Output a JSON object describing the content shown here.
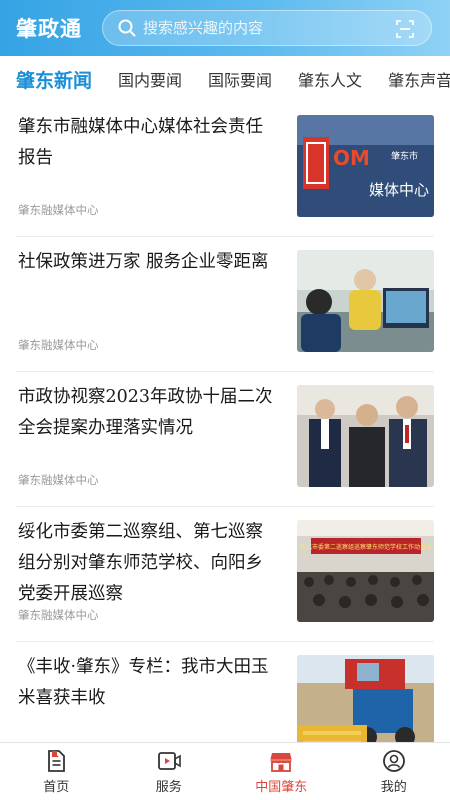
{
  "header": {
    "app_title": "肇政通",
    "search_placeholder": "搜索感兴趣的内容",
    "search_icon": "search-icon",
    "scan_icon": "scan-icon"
  },
  "tabs": [
    {
      "label": "肇东新闻",
      "active": true
    },
    {
      "label": "国内要闻"
    },
    {
      "label": "国际要闻"
    },
    {
      "label": "肇东人文"
    },
    {
      "label": "肇东声音"
    }
  ],
  "news": [
    {
      "title": "肇东市融媒体中心媒体社会责任报告",
      "source": "肇东融媒体中心"
    },
    {
      "title": "社保政策进万家 服务企业零距离",
      "source": "肇东融媒体中心"
    },
    {
      "title": "市政协视察2023年政协十届二次全会提案办理落实情况",
      "source": "肇东融媒体中心"
    },
    {
      "title": "绥化市委第二巡察组、第七巡察组分别对肇东师范学校、向阳乡党委开展巡察",
      "source": "肇东融媒体中心"
    },
    {
      "title": "《丰收·肇东》专栏：我市大田玉米喜获丰收",
      "source": ""
    }
  ],
  "thumb_text": {
    "logo_letters": "OM",
    "media_center_label": "媒体中心",
    "city_label": "肇东市",
    "banner_text": "绥化市委第二巡察组巡察肇东师范学校工作动员会"
  },
  "bottom_nav": [
    {
      "label": "首页",
      "icon": "home-icon"
    },
    {
      "label": "服务",
      "icon": "video-service-icon"
    },
    {
      "label": "中国肇东",
      "icon": "store-icon",
      "active": true
    },
    {
      "label": "我的",
      "icon": "profile-icon"
    }
  ],
  "colors": {
    "header_start": "#35a3e4",
    "header_end": "#8fd2f6",
    "tab_active": "#1a8fd6",
    "nav_active": "#d9463b",
    "source_text": "#9a9a9a"
  }
}
